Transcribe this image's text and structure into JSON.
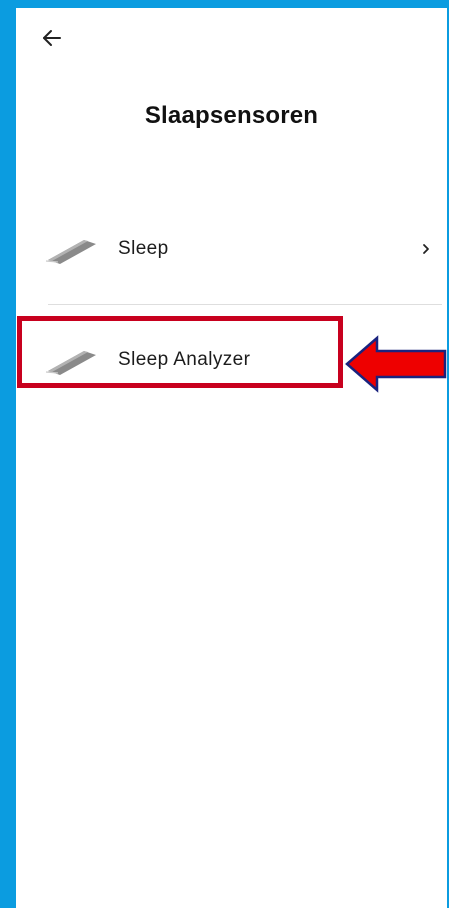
{
  "header": {
    "back_icon": "arrow-left-icon",
    "title": "Slaapsensoren"
  },
  "sensors": {
    "items": [
      {
        "label": "Sleep",
        "icon": "sleep-pad-icon",
        "chevron": "chevron-right-icon"
      },
      {
        "label": "Sleep Analyzer",
        "icon": "sleep-pad-icon"
      }
    ]
  },
  "annotation": {
    "highlight_color": "#c8001e",
    "arrow_color": "#ee0000",
    "arrow_outline_color": "#1a237e"
  }
}
